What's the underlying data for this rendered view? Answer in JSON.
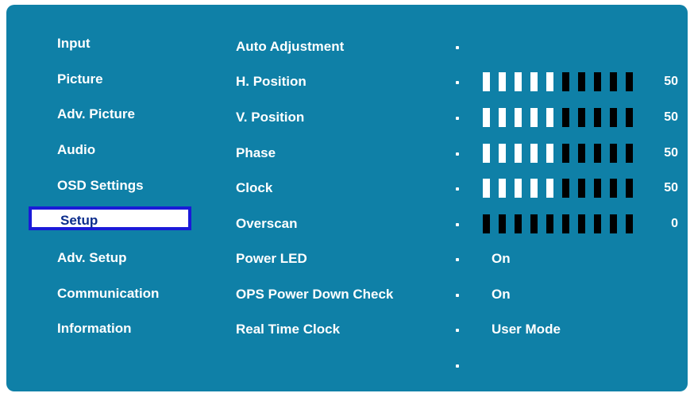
{
  "menu": {
    "items": [
      {
        "label": "Input"
      },
      {
        "label": "Picture"
      },
      {
        "label": "Adv. Picture"
      },
      {
        "label": "Audio"
      },
      {
        "label": "OSD Settings"
      },
      {
        "label": "Setup"
      },
      {
        "label": "Adv. Setup"
      },
      {
        "label": "Communication"
      },
      {
        "label": "Information"
      }
    ],
    "selected": "Setup"
  },
  "settings": [
    {
      "label": "Auto Adjustment",
      "type": "action"
    },
    {
      "label": "H. Position",
      "type": "bar",
      "value": 50,
      "level": 0.5
    },
    {
      "label": "V. Position",
      "type": "bar",
      "value": 50,
      "level": 0.5
    },
    {
      "label": "Phase",
      "type": "bar",
      "value": 50,
      "level": 0.5
    },
    {
      "label": "Clock",
      "type": "bar",
      "value": 50,
      "level": 0.5
    },
    {
      "label": "Overscan",
      "type": "bar",
      "value": 0,
      "level": 0
    },
    {
      "label": "Power LED",
      "type": "text",
      "value": "On"
    },
    {
      "label": "OPS Power Down Check",
      "type": "text",
      "value": "On"
    },
    {
      "label": "Real Time Clock",
      "type": "text",
      "value": "User Mode"
    }
  ],
  "colors": {
    "background": "#0f80a7",
    "text": "#ffffff",
    "selection_border": "#1a1ad8",
    "selection_text": "#0b2d8c",
    "bar_on": "#ffffff",
    "bar_off": "#000000"
  }
}
